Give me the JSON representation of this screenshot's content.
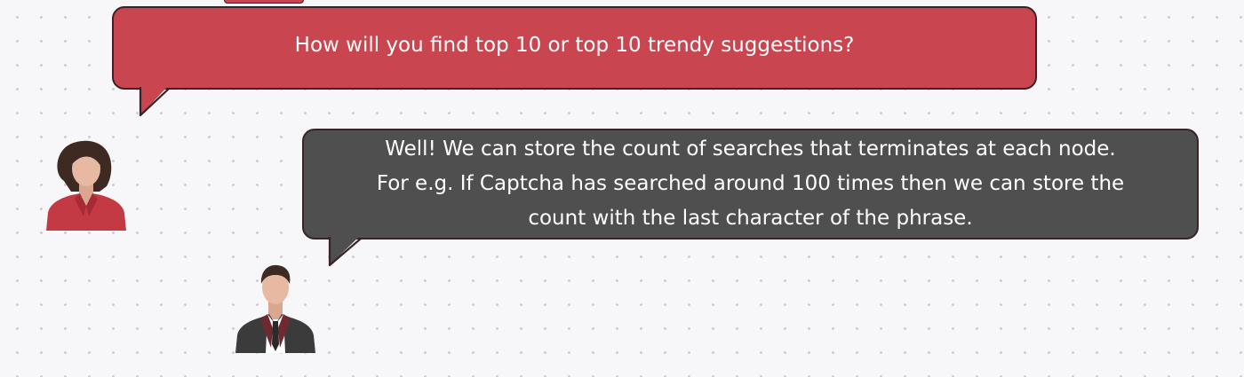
{
  "question": {
    "text": "How will you find top 10 or top 10 trendy suggestions?"
  },
  "answer": {
    "lines": [
      "Well! We can store the count of searches that terminates at each node.",
      "For e.g. If Captcha has searched around 100 times then we can store the",
      "count with the last character of the phrase."
    ]
  },
  "colors": {
    "question_bubble": "#c9454f",
    "answer_bubble": "#4f4f4f",
    "outline": "#3a2226",
    "female_blazer": "#c43a44",
    "male_suit": "#3b3b3b",
    "skin": "#e8b9a2"
  },
  "icons": {
    "female": "female-avatar-icon",
    "male": "male-avatar-icon"
  }
}
